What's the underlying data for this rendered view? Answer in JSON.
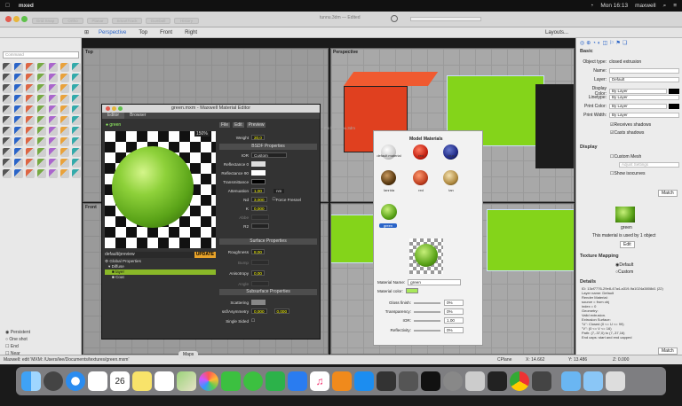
{
  "menubar": {
    "app_name": "mxed",
    "clock": "Mon 16:13",
    "user": "maxwell"
  },
  "window": {
    "doc_title": "tunnu.3dm — Edited",
    "ghost_buttons": [
      "Grid Snap",
      "Ortho",
      "Planar",
      "SmartTrack",
      "Gumball",
      "History"
    ],
    "search_placeholder": "Perspective"
  },
  "viewport_tabs": {
    "items": [
      "Perspective",
      "Top",
      "Front",
      "Right"
    ],
    "layouts": "Layouts..."
  },
  "left": {
    "command_placeholder": "Command",
    "snaps": [
      "Persistent",
      "One shot",
      "End",
      "Near",
      "Point"
    ]
  },
  "viewports": {
    "top": "Top",
    "perspective": "Perspective",
    "front": "Front"
  },
  "properties": {
    "basic": "Basic",
    "object_type_label": "Object type:",
    "object_type": "closed extrusion",
    "name_label": "Name:",
    "name": "",
    "layer_label": "Layer:",
    "layer": "Default",
    "display_color_label": "Display Color:",
    "display_color": "By Layer",
    "linetype_label": "Linetype:",
    "linetype": "By Layer",
    "print_color_label": "Print Color:",
    "print_color": "By Layer",
    "print_width_label": "Print Width:",
    "print_width": "By Layer",
    "receives_shadows": "Receives shadows",
    "casts_shadows": "Casts shadows",
    "display": "Display",
    "custom_mesh": "Custom Mesh",
    "adjust_settings": "Adjust Settings",
    "show_isocurves": "Show isocurves",
    "match": "Match",
    "material_name": "green",
    "material_used": "This material is used by 1 object",
    "edit": "Edit",
    "texture_mapping": "Texture Mapping",
    "default_opt": "Default",
    "custom_opt": "Custom",
    "details": "Details",
    "details_text": [
      "ID: 13cf7776-29e8-47a4-a319-9a1024a3808d1 (22)",
      "Layer name: Default",
      "Render Material:",
      "  source = from obj",
      "  index = 0",
      "Geometry:",
      "  Valid extrusion.",
      "  Extrusion Surface:",
      "  \"U\": Closed (0 <= U <= 99)",
      "  \"V\": (0 <= V <= 16)",
      "  Path: (7,-37,0) to (7,-37,16)",
      "  End caps: start and end capped"
    ],
    "match2": "Match"
  },
  "mated": {
    "title": "green.mxm - Maxwell Material Editor",
    "tabs": [
      "Editor",
      "Browser"
    ],
    "menus": [
      "File",
      "Edit",
      "Preview"
    ],
    "material": "green",
    "zoom": "150%",
    "weight_label": "Weight",
    "weight": "20,0",
    "bsdf": "BSDF Properties",
    "ior_label": "IOR",
    "ior": "Custom",
    "refl0": "Reflectance 0",
    "refl90": "Reflectance 90",
    "trans": "Transmittance",
    "atten_label": "Attenuation",
    "atten": "1,00",
    "atten_unit": "nm",
    "nd_label": "Nd",
    "nd": "3,000",
    "k_label": "K",
    "k": "0,000",
    "abbe_label": "Abbe",
    "abbe": "",
    "r2_label": "R2",
    "r2": "",
    "force_fresnel": "Force Fresnel",
    "surface": "Surface Properties",
    "rough_label": "Roughness",
    "rough": "8,00",
    "bump_label": "Bump",
    "bump": "",
    "aniso_label": "Anisotropy",
    "aniso": "0,00",
    "angle_label": "Angle",
    "angle": "",
    "subsurface": "Subsurface Properties",
    "scatter_label": "Scattering",
    "asym_label": "ssf/Asymmetry",
    "asym": "0,000",
    "asym2": "0,000",
    "single_sided": "Single Sided",
    "preview_scene": "default/preview",
    "update": "UPDATE",
    "tree": [
      "Global Properties",
      "Diffuse",
      "layer",
      "Coat"
    ]
  },
  "browser": {
    "title": "Model Materials",
    "file_label": "ms for tunnu.3dm",
    "swatches": [
      "default material",
      "red",
      "blue",
      "Ianrida",
      "red",
      "tan"
    ],
    "selected": "green",
    "mat_name_label": "Material Name:",
    "mat_name": "green",
    "mat_color_label": "Material color:",
    "gloss_label": "Gloss finish:",
    "gloss": "0%",
    "transp_label": "Transparency:",
    "transp": "0%",
    "ior_label": "IOR:",
    "ior": "1.00",
    "refl_label": "Reflectivity:",
    "refl": "0%"
  },
  "status": {
    "text": "Maxwell: edit 'MXM: /Users/lee/Documents/textures/green.mxm'",
    "cplane": "CPlane",
    "x": "X: 14.662",
    "y": "Y: 13.486",
    "z": "Z: 0.000"
  },
  "dock": {
    "tooltip": "Maps",
    "calendar_day": "26"
  }
}
